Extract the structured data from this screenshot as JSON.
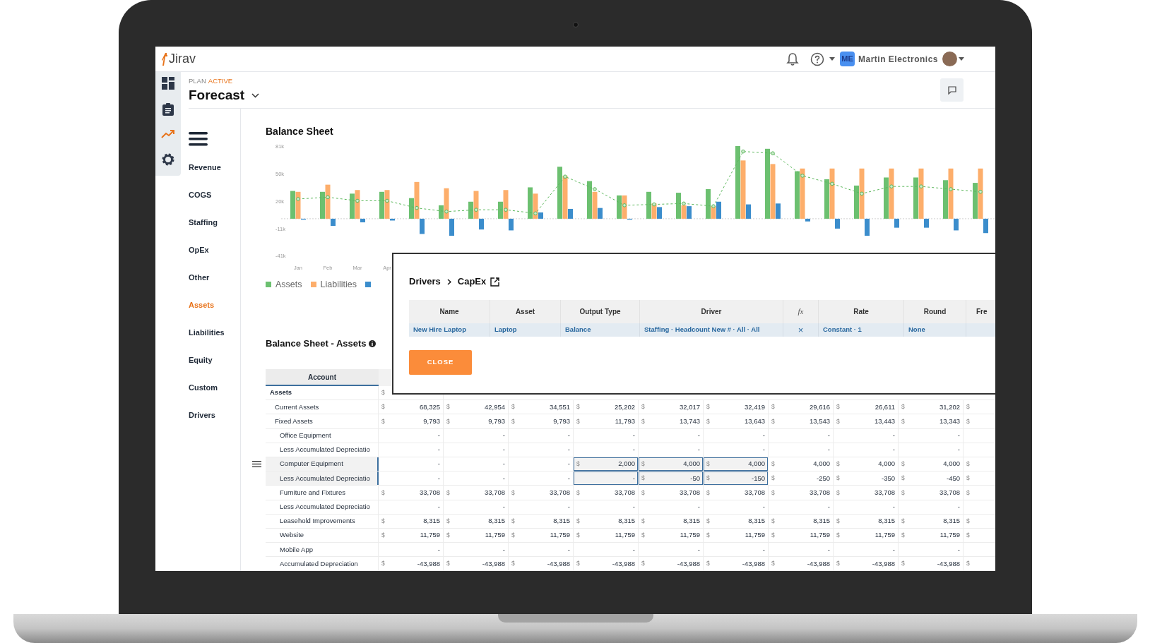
{
  "app": {
    "logo": "Jirav",
    "account_initials": "ME",
    "account_name": "Martin Electronics"
  },
  "rail": [
    {
      "kind": "dashboard",
      "selected": false
    },
    {
      "kind": "clipboard",
      "selected": false
    },
    {
      "kind": "trend",
      "selected": true
    },
    {
      "kind": "settings",
      "selected": false
    }
  ],
  "plan": {
    "label": "PLAN",
    "status": "ACTIVE",
    "name": "Forecast"
  },
  "nav": [
    {
      "label": "Revenue",
      "selected": false
    },
    {
      "label": "COGS",
      "selected": false
    },
    {
      "label": "Staffing",
      "selected": false
    },
    {
      "label": "OpEx",
      "selected": false
    },
    {
      "label": "Other",
      "selected": false
    },
    {
      "label": "Assets",
      "selected": true
    },
    {
      "label": "Liabilities",
      "selected": false
    },
    {
      "label": "Equity",
      "selected": false
    },
    {
      "label": "Custom",
      "selected": false
    },
    {
      "label": "Drivers",
      "selected": false
    }
  ],
  "chart": {
    "title": "Balance Sheet",
    "chart_data": {
      "type": "bar",
      "stacked": false,
      "ylim": [
        -41000,
        81000
      ],
      "ref_lines": [
        {
          "axis": "y",
          "value": 0,
          "line_style": "dotted"
        }
      ],
      "yticks": [
        {
          "value": 81000,
          "label": "81k"
        },
        {
          "value": 50000,
          "label": "50k"
        },
        {
          "value": 20000,
          "label": "20k"
        },
        {
          "value": -11000,
          "label": "-11k"
        },
        {
          "value": -41000,
          "label": "-41k"
        }
      ],
      "categories": [
        "Jan",
        "Feb",
        "Mar",
        "Apr",
        null,
        null,
        null,
        null,
        null,
        null,
        null,
        null,
        null,
        null,
        null,
        null,
        null,
        null,
        null,
        null,
        null,
        null,
        null,
        null
      ],
      "series": [
        {
          "name": "Assets",
          "color": "#6cc070",
          "values": [
            31000,
            30000,
            28000,
            30000,
            23000,
            15000,
            19000,
            19000,
            35000,
            58000,
            42000,
            26000,
            30000,
            29000,
            33000,
            81000,
            78000,
            53000,
            44000,
            37000,
            46000,
            46000,
            43000,
            40000
          ]
        },
        {
          "name": "Liabilities",
          "color": "#fdae6b",
          "values": [
            30000,
            38000,
            32000,
            32000,
            41000,
            34000,
            31000,
            32000,
            28000,
            48000,
            30000,
            26000,
            17000,
            15000,
            14000,
            65000,
            61000,
            56000,
            56000,
            56000,
            56000,
            56000,
            56000,
            56000
          ]
        },
        {
          "color": "#3b8dcc",
          "values": [
            -1000,
            -8000,
            -4000,
            -2000,
            -17000,
            -19000,
            -12000,
            -13000,
            7000,
            11000,
            12000,
            -1000,
            13000,
            14000,
            19000,
            16000,
            17000,
            -3000,
            -11000,
            -19000,
            -10000,
            -10000,
            -13000,
            -16000
          ]
        },
        {
          "color": "#5cb85c",
          "type": "line",
          "line_style": "dashed",
          "marker": "circle",
          "values": [
            22000,
            24000,
            20000,
            20000,
            12000,
            8000,
            10000,
            10000,
            6000,
            47000,
            33000,
            15000,
            16000,
            17000,
            14000,
            75000,
            73000,
            48000,
            39000,
            28000,
            36000,
            36000,
            33000,
            30000
          ]
        }
      ]
    }
  },
  "table": {
    "title": "Balance Sheet - Assets",
    "columns": [
      "Account"
    ],
    "rows": [
      {
        "label": "Assets",
        "selected": false,
        "cells": [
          {
            "sign": "$",
            "selected": false
          }
        ],
        "children": [
          {
            "label": "Current Assets",
            "selected": false,
            "cells": [
              {
                "sign": "$",
                "value": "68,325",
                "selected": false
              },
              {
                "sign": "$",
                "value": "42,954",
                "selected": false
              },
              {
                "sign": "$",
                "value": "34,551",
                "selected": false
              },
              {
                "sign": "$",
                "value": "25,202",
                "selected": false
              },
              {
                "sign": "$",
                "value": "32,017",
                "selected": false
              },
              {
                "sign": "$",
                "value": "32,419",
                "selected": false
              },
              {
                "sign": "$",
                "value": "29,616",
                "selected": false
              },
              {
                "sign": "$",
                "value": "26,611",
                "selected": false
              },
              {
                "sign": "$",
                "value": "31,202",
                "selected": false
              },
              {
                "sign": "$",
                "selected": false
              }
            ]
          },
          {
            "label": "Fixed Assets",
            "selected": false,
            "cells": [
              {
                "sign": "$",
                "value": "9,793",
                "selected": false
              },
              {
                "sign": "$",
                "value": "9,793",
                "selected": false
              },
              {
                "sign": "$",
                "value": "9,793",
                "selected": false
              },
              {
                "sign": "$",
                "value": "11,793",
                "selected": false
              },
              {
                "sign": "$",
                "value": "13,743",
                "selected": false
              },
              {
                "sign": "$",
                "value": "13,643",
                "selected": false
              },
              {
                "sign": "$",
                "value": "13,543",
                "selected": false
              },
              {
                "sign": "$",
                "value": "13,443",
                "selected": false
              },
              {
                "sign": "$",
                "value": "13,343",
                "selected": false
              },
              {
                "sign": "$",
                "selected": false
              }
            ],
            "children": [
              {
                "label": "Office Equipment",
                "selected": false,
                "cells": [
                  {
                    "value": "-",
                    "selected": false
                  },
                  {
                    "value": "-",
                    "selected": false
                  },
                  {
                    "value": "-",
                    "selected": false
                  },
                  {
                    "value": "-",
                    "selected": false
                  },
                  {
                    "value": "-",
                    "selected": false
                  },
                  {
                    "value": "-",
                    "selected": false
                  },
                  {
                    "value": "-",
                    "selected": false
                  },
                  {
                    "value": "-",
                    "selected": false
                  },
                  {
                    "value": "-",
                    "selected": false
                  }
                ]
              },
              {
                "label": "Less Accumulated Depreciatio",
                "selected": false,
                "cells": [
                  {
                    "value": "-",
                    "selected": false
                  },
                  {
                    "value": "-",
                    "selected": false
                  },
                  {
                    "value": "-",
                    "selected": false
                  },
                  {
                    "value": "-",
                    "selected": false
                  },
                  {
                    "value": "-",
                    "selected": false
                  },
                  {
                    "value": "-",
                    "selected": false
                  },
                  {
                    "value": "-",
                    "selected": false
                  },
                  {
                    "value": "-",
                    "selected": false
                  },
                  {
                    "value": "-",
                    "selected": false
                  }
                ]
              },
              {
                "label": "Computer Equipment",
                "selected": true,
                "handle": true,
                "cells": [
                  {
                    "value": "-",
                    "selected": false
                  },
                  {
                    "value": "-",
                    "selected": false
                  },
                  {
                    "value": "-",
                    "selected": false
                  },
                  {
                    "sign": "$",
                    "value": "2,000",
                    "selected": true
                  },
                  {
                    "sign": "$",
                    "value": "4,000",
                    "selected": true
                  },
                  {
                    "sign": "$",
                    "value": "4,000",
                    "selected": true
                  },
                  {
                    "sign": "$",
                    "value": "4,000",
                    "selected": false
                  },
                  {
                    "sign": "$",
                    "value": "4,000",
                    "selected": false
                  },
                  {
                    "sign": "$",
                    "value": "4,000",
                    "selected": false
                  },
                  {
                    "sign": "$",
                    "selected": false
                  }
                ]
              },
              {
                "label": "Less Accumulated Depreciatio",
                "selected": true,
                "cells": [
                  {
                    "value": "-",
                    "selected": false
                  },
                  {
                    "value": "-",
                    "selected": false
                  },
                  {
                    "value": "-",
                    "selected": false
                  },
                  {
                    "value": "-",
                    "selected": true
                  },
                  {
                    "sign": "$",
                    "value": "-50",
                    "selected": true
                  },
                  {
                    "sign": "$",
                    "value": "-150",
                    "selected": true
                  },
                  {
                    "sign": "$",
                    "value": "-250",
                    "selected": false
                  },
                  {
                    "sign": "$",
                    "value": "-350",
                    "selected": false
                  },
                  {
                    "sign": "$",
                    "value": "-450",
                    "selected": false
                  },
                  {
                    "sign": "$",
                    "selected": false
                  }
                ]
              },
              {
                "label": "Furniture and Fixtures",
                "selected": false,
                "cells": [
                  {
                    "sign": "$",
                    "value": "33,708",
                    "selected": false
                  },
                  {
                    "sign": "$",
                    "value": "33,708",
                    "selected": false
                  },
                  {
                    "sign": "$",
                    "value": "33,708",
                    "selected": false
                  },
                  {
                    "sign": "$",
                    "value": "33,708",
                    "selected": false
                  },
                  {
                    "sign": "$",
                    "value": "33,708",
                    "selected": false
                  },
                  {
                    "sign": "$",
                    "value": "33,708",
                    "selected": false
                  },
                  {
                    "sign": "$",
                    "value": "33,708",
                    "selected": false
                  },
                  {
                    "sign": "$",
                    "value": "33,708",
                    "selected": false
                  },
                  {
                    "sign": "$",
                    "value": "33,708",
                    "selected": false
                  },
                  {
                    "sign": "$",
                    "selected": false
                  }
                ]
              },
              {
                "label": "Less Accumulated Depreciatio",
                "selected": false,
                "cells": [
                  {
                    "value": "-",
                    "selected": false
                  },
                  {
                    "value": "-",
                    "selected": false
                  },
                  {
                    "value": "-",
                    "selected": false
                  },
                  {
                    "value": "-",
                    "selected": false
                  },
                  {
                    "value": "-",
                    "selected": false
                  },
                  {
                    "value": "-",
                    "selected": false
                  },
                  {
                    "value": "-",
                    "selected": false
                  },
                  {
                    "value": "-",
                    "selected": false
                  },
                  {
                    "value": "-",
                    "selected": false
                  }
                ]
              },
              {
                "label": "Leasehold Improvements",
                "selected": false,
                "cells": [
                  {
                    "sign": "$",
                    "value": "8,315",
                    "selected": false
                  },
                  {
                    "sign": "$",
                    "value": "8,315",
                    "selected": false
                  },
                  {
                    "sign": "$",
                    "value": "8,315",
                    "selected": false
                  },
                  {
                    "sign": "$",
                    "value": "8,315",
                    "selected": false
                  },
                  {
                    "sign": "$",
                    "value": "8,315",
                    "selected": false
                  },
                  {
                    "sign": "$",
                    "value": "8,315",
                    "selected": false
                  },
                  {
                    "sign": "$",
                    "value": "8,315",
                    "selected": false
                  },
                  {
                    "sign": "$",
                    "value": "8,315",
                    "selected": false
                  },
                  {
                    "sign": "$",
                    "value": "8,315",
                    "selected": false
                  },
                  {
                    "sign": "$",
                    "selected": false
                  }
                ]
              },
              {
                "label": "Website",
                "selected": false,
                "cells": [
                  {
                    "sign": "$",
                    "value": "11,759",
                    "selected": false
                  },
                  {
                    "sign": "$",
                    "value": "11,759",
                    "selected": false
                  },
                  {
                    "sign": "$",
                    "value": "11,759",
                    "selected": false
                  },
                  {
                    "sign": "$",
                    "value": "11,759",
                    "selected": false
                  },
                  {
                    "sign": "$",
                    "value": "11,759",
                    "selected": false
                  },
                  {
                    "sign": "$",
                    "value": "11,759",
                    "selected": false
                  },
                  {
                    "sign": "$",
                    "value": "11,759",
                    "selected": false
                  },
                  {
                    "sign": "$",
                    "value": "11,759",
                    "selected": false
                  },
                  {
                    "sign": "$",
                    "value": "11,759",
                    "selected": false
                  },
                  {
                    "sign": "$",
                    "selected": false
                  }
                ]
              },
              {
                "label": "Mobile App",
                "selected": false,
                "cells": [
                  {
                    "value": "-",
                    "selected": false
                  },
                  {
                    "value": "-",
                    "selected": false
                  },
                  {
                    "value": "-",
                    "selected": false
                  },
                  {
                    "value": "-",
                    "selected": false
                  },
                  {
                    "value": "-",
                    "selected": false
                  },
                  {
                    "value": "-",
                    "selected": false
                  },
                  {
                    "value": "-",
                    "selected": false
                  },
                  {
                    "value": "-",
                    "selected": false
                  },
                  {
                    "value": "-",
                    "selected": false
                  }
                ]
              },
              {
                "label": "Accumulated Depreciation",
                "selected": false,
                "cells": [
                  {
                    "sign": "$",
                    "value": "-43,988",
                    "selected": false
                  },
                  {
                    "sign": "$",
                    "value": "-43,988",
                    "selected": false
                  },
                  {
                    "sign": "$",
                    "value": "-43,988",
                    "selected": false
                  },
                  {
                    "sign": "$",
                    "value": "-43,988",
                    "selected": false
                  },
                  {
                    "sign": "$",
                    "value": "-43,988",
                    "selected": false
                  },
                  {
                    "sign": "$",
                    "value": "-43,988",
                    "selected": false
                  },
                  {
                    "sign": "$",
                    "value": "-43,988",
                    "selected": false
                  },
                  {
                    "sign": "$",
                    "value": "-43,988",
                    "selected": false
                  },
                  {
                    "sign": "$",
                    "value": "-43,988",
                    "selected": false
                  },
                  {
                    "sign": "$",
                    "selected": false
                  }
                ]
              }
            ]
          }
        ]
      }
    ]
  },
  "modal": {
    "breadcrumb": [
      "Drivers",
      "CapEx"
    ],
    "columns": [
      {
        "label": "Name",
        "kind": "text"
      },
      {
        "label": "Asset",
        "kind": "text"
      },
      {
        "label": "Output Type",
        "kind": "text"
      },
      {
        "label": "Driver",
        "kind": "text"
      },
      {
        "label": "fx",
        "kind": "formula"
      },
      {
        "label": "Rate",
        "kind": "text"
      },
      {
        "label": "Round",
        "kind": "text"
      },
      {
        "label": "Fre",
        "kind": "text"
      }
    ],
    "rows": [
      {
        "cells": [
          "New Hire Laptop",
          "Laptop",
          "Balance",
          "Staffing · Headcount New # · All · All",
          "×",
          "Constant · 1",
          "None"
        ]
      }
    ],
    "close_button": "CLOSE"
  }
}
